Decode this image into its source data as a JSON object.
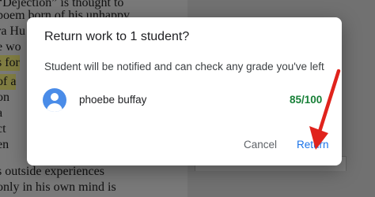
{
  "background": {
    "document_lines": [
      {
        "text": "“Dejection” is thought to",
        "highlight": false
      },
      {
        "text": "poem born of his unhappy",
        "highlight": false
      },
      {
        "text": "ra Hu",
        "highlight": false
      },
      {
        "text": "e wo",
        "highlight": false
      },
      {
        "text": "s for",
        "highlight": true
      },
      {
        "text": "of a",
        "highlight": true
      },
      {
        "text": "on",
        "highlight": false
      },
      {
        "text": "a",
        "highlight": false
      },
      {
        "text": "ct",
        "highlight": false
      },
      {
        "text": "en",
        "highlight": false
      },
      {
        "text": "s outside experiences",
        "highlight": false
      },
      {
        "text": "only in his own mind is",
        "highlight": false
      }
    ],
    "highlight_color": "#f3ee7e"
  },
  "dialog": {
    "title": "Return work to 1 student?",
    "message": "Student will be notified and can check any grade you've left",
    "student": {
      "name": "phoebe buffay",
      "grade": "85/100"
    },
    "cancel_label": "Cancel",
    "return_label": "Return"
  },
  "colors": {
    "accent": "#1a73e8",
    "grade": "#188038",
    "avatar": "#4a8ce8",
    "annotation_arrow": "#e0231c"
  },
  "icons": {
    "avatar": "person-avatar-icon",
    "annotation": "red-arrow"
  }
}
